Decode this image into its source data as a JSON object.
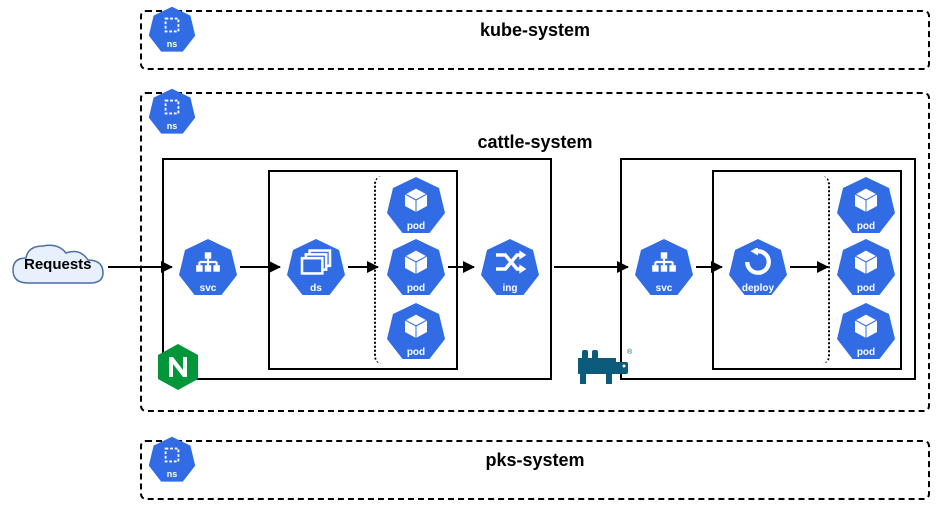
{
  "namespaces": {
    "kube": {
      "label": "kube-system",
      "badge": "ns"
    },
    "cattle": {
      "label": "cattle-system",
      "badge": "ns"
    },
    "pks": {
      "label": "pks-system",
      "badge": "ns"
    }
  },
  "nodes": {
    "requests": {
      "label": "Requests"
    },
    "svc1": {
      "label": "svc"
    },
    "ds": {
      "label": "ds"
    },
    "pod1": {
      "label": "pod"
    },
    "pod2": {
      "label": "pod"
    },
    "pod3": {
      "label": "pod"
    },
    "ing": {
      "label": "ing"
    },
    "svc2": {
      "label": "svc"
    },
    "deploy": {
      "label": "deploy"
    },
    "pod4": {
      "label": "pod"
    },
    "pod5": {
      "label": "pod"
    },
    "pod6": {
      "label": "pod"
    }
  },
  "colors": {
    "k8sBlue": "#326CE5",
    "nginxGreen": "#009639",
    "rancherTeal": "#0C5A7C",
    "cloudFill": "#E8F0FE",
    "cloudStroke": "#4A6FA5"
  }
}
